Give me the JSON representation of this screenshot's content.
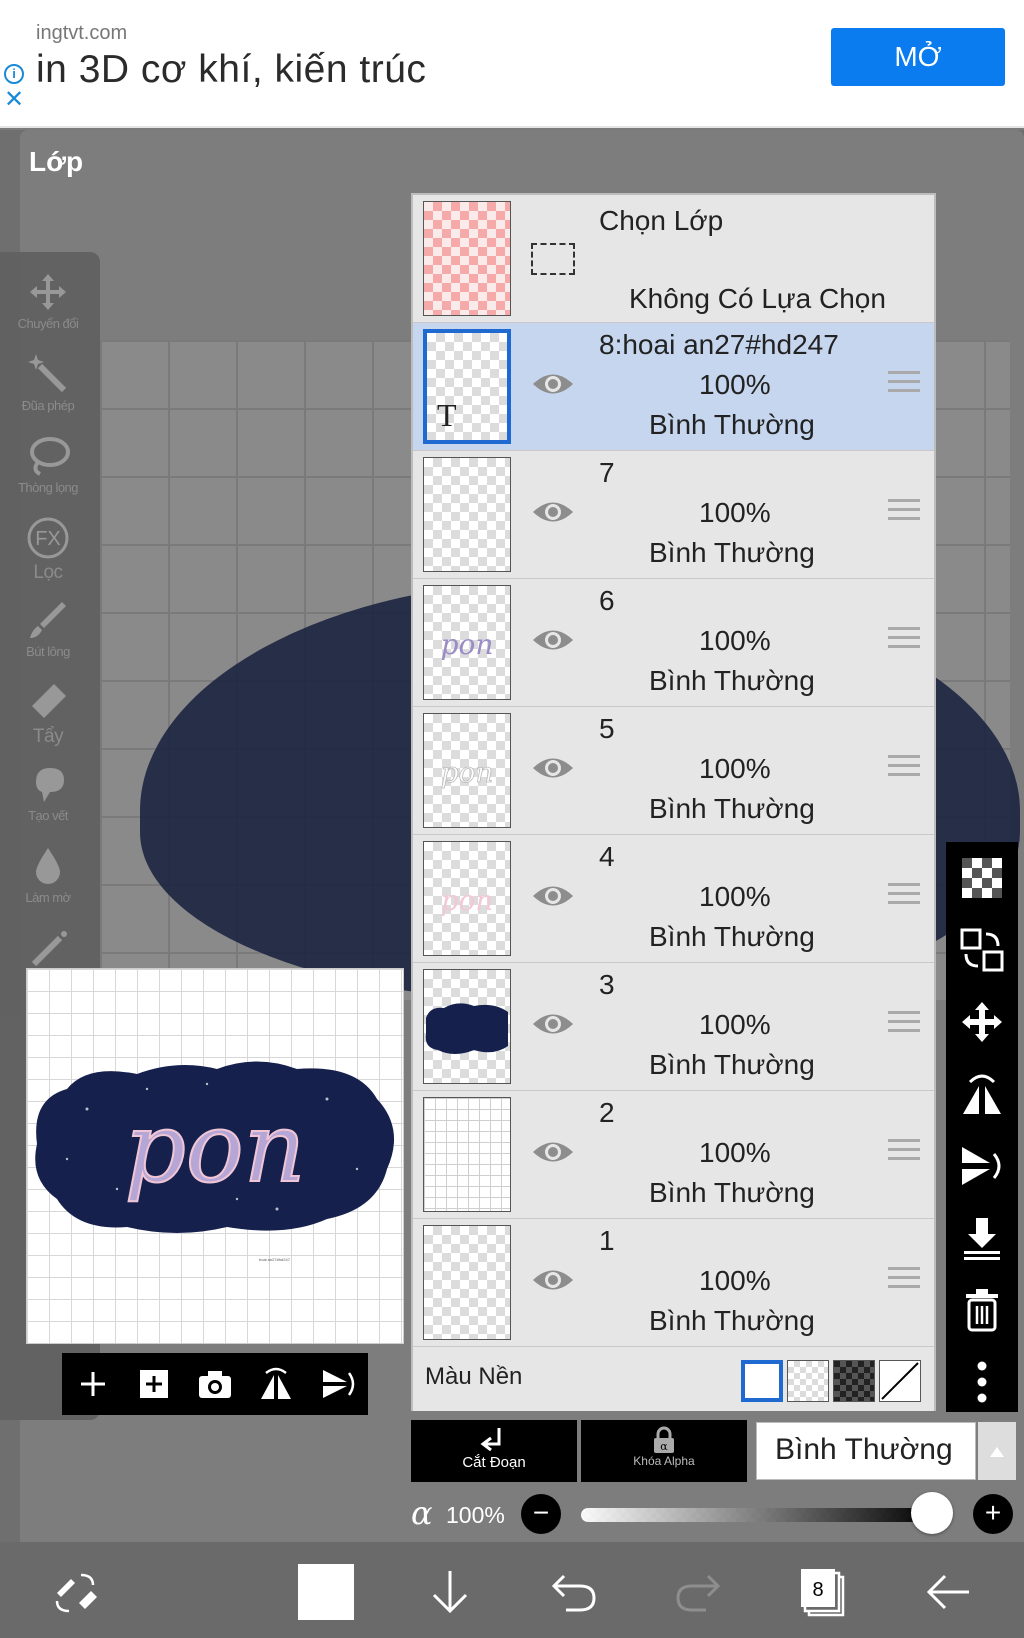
{
  "ad": {
    "domain": "ingtvt.com",
    "headline": "in 3D cơ khí, kiến trúc",
    "open_button": "MỞ",
    "info_glyph": "i",
    "close_glyph": "✕"
  },
  "panel_title": "Lớp",
  "tools": [
    {
      "label": "Chuyển đổi",
      "icon": "move-icon"
    },
    {
      "label": "Đũa phép",
      "icon": "magic-wand-icon"
    },
    {
      "label": "Thòng lọng",
      "icon": "lasso-icon"
    },
    {
      "label": "Lọc",
      "icon": "fx-filter-icon"
    },
    {
      "label": "Bút lông",
      "icon": "brush-icon"
    },
    {
      "label": "Tẩy",
      "icon": "eraser-icon"
    },
    {
      "label": "Tạo vết",
      "icon": "smudge-icon"
    },
    {
      "label": "Làm mờ",
      "icon": "blur-icon"
    }
  ],
  "fx_text": "FX",
  "preview": {
    "word": "pon",
    "tiny_caption": "hoai an27#hd247"
  },
  "selection": {
    "title": "Chọn Lớp",
    "subtitle": "Không Có Lựa Chọn"
  },
  "layers": [
    {
      "name": "8:hoai an27#hd247",
      "opacity": "100%",
      "mode": "Bình Thường",
      "active": true,
      "thumb_letter": "T"
    },
    {
      "name": "7",
      "opacity": "100%",
      "mode": "Bình Thường"
    },
    {
      "name": "6",
      "opacity": "100%",
      "mode": "Bình Thường",
      "thumb_text": "pon"
    },
    {
      "name": "5",
      "opacity": "100%",
      "mode": "Bình Thường",
      "thumb_text": "pon"
    },
    {
      "name": "4",
      "opacity": "100%",
      "mode": "Bình Thường",
      "thumb_text": "pon"
    },
    {
      "name": "3",
      "opacity": "100%",
      "mode": "Bình Thường"
    },
    {
      "name": "2",
      "opacity": "100%",
      "mode": "Bình Thường"
    },
    {
      "name": "1",
      "opacity": "100%",
      "mode": "Bình Thường"
    }
  ],
  "background": {
    "label": "Màu Nền"
  },
  "controls": {
    "clip_label": "Cắt Đoạn",
    "alpha_lock_label": "Khóa Alpha",
    "blend_mode": "Bình Thường",
    "alpha_symbol": "α",
    "alpha_value": "100%",
    "alpha_fraction": 1.0,
    "minus": "−",
    "plus": "+"
  },
  "bottom_nav": {
    "layer_count": "8"
  },
  "colors": {
    "accent": "#1e6ad0",
    "ad_button": "#0b7cf0",
    "active_row": "#c6d6ee",
    "navy": "#1c2340"
  }
}
